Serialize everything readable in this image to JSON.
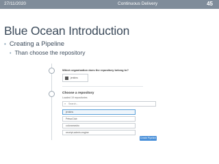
{
  "slide": {
    "date": "27/11/2020",
    "footer_title": "Continuous Delivery",
    "page_number": "45",
    "title": "Blue Ocean Introduction",
    "bullet1": "Creating a Pipeline",
    "bullet2": "Than choose the repository"
  },
  "wizard": {
    "org_question": "Which organisation does the repository belong to?",
    "org_name": "jenkins",
    "choose_heading": "Choose a repository",
    "loaded_text": "Loaded 19 repositories",
    "search_placeholder": "Search...",
    "repositories": [
      "jenkins",
      "PetsoClub",
      "colorarrasbo",
      "receipt-admin-engine"
    ],
    "create_button": "Create Pipeline",
    "colors": {
      "accent": "#4a90d9",
      "header_bar": "#7f8c9a"
    }
  }
}
